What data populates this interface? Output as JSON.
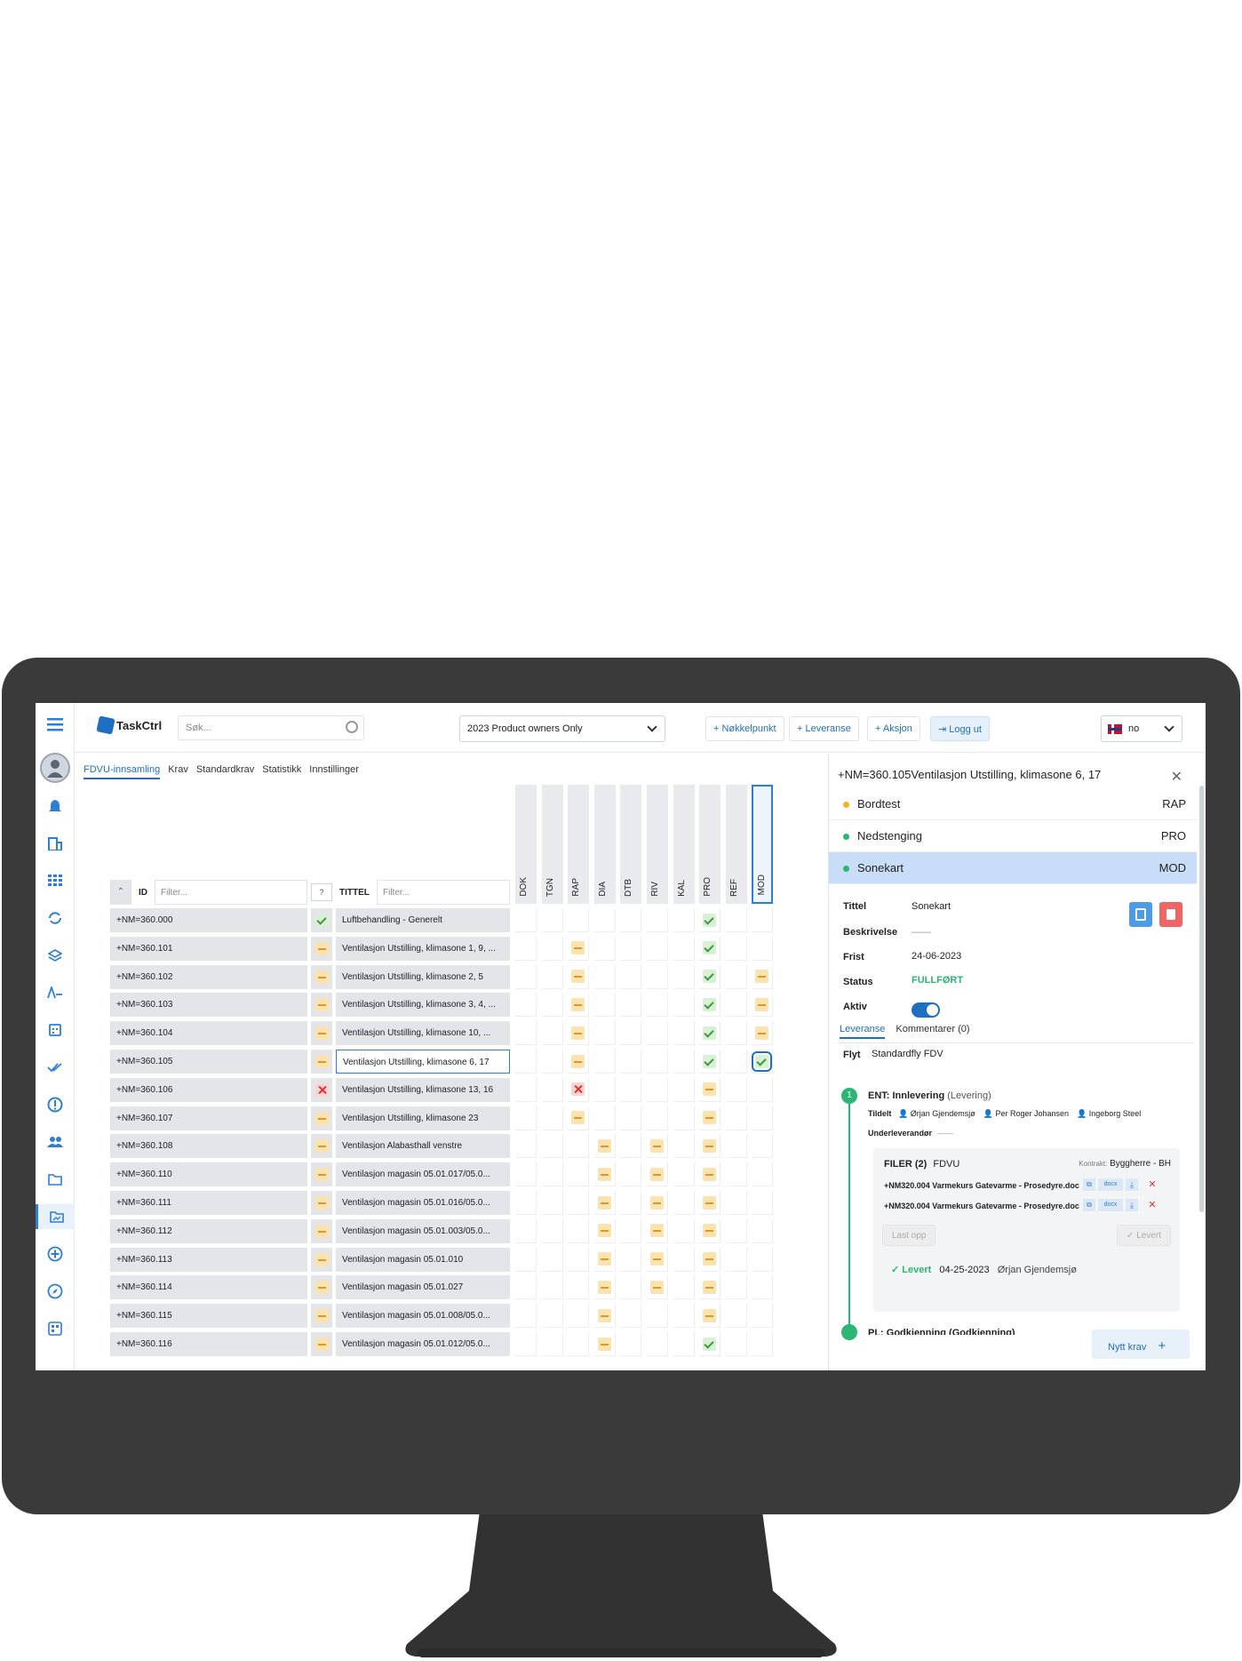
{
  "app": {
    "logo_text": "TaskCtrl",
    "search_placeholder": "Søk...",
    "project": "2023 Product owners Only",
    "buttons": [
      "Nøkkelpunkt",
      "Leveranse",
      "Aksjon",
      "Logg ut"
    ],
    "lang": "no"
  },
  "subtabs": [
    "FDVU-innsamling",
    "Krav",
    "Standardkrav",
    "Statistikk",
    "Innstillinger"
  ],
  "grid": {
    "id_label": "ID",
    "status_label": "?",
    "title_label": "TITTEL",
    "filter_placeholder": "Filter...",
    "columns": [
      "DOK",
      "TGN",
      "RAP",
      "DIA",
      "DTB",
      "RIV",
      "KAL",
      "PRO",
      "REF",
      "MOD"
    ],
    "rows": [
      {
        "id": "+NM=360.000",
        "st": "ok",
        "title": "Luftbehandling - Generelt",
        "marks": {
          "PRO": "ok"
        }
      },
      {
        "id": "+NM=360.101",
        "st": "pend",
        "title": "Ventilasjon Utstilling, klimasone 1, 9, ...",
        "marks": {
          "RAP": "pend",
          "PRO": "ok"
        }
      },
      {
        "id": "+NM=360.102",
        "st": "pend",
        "title": "Ventilasjon Utstilling, klimasone 2, 5",
        "marks": {
          "RAP": "pend",
          "PRO": "ok",
          "MOD": "pend"
        }
      },
      {
        "id": "+NM=360.103",
        "st": "pend",
        "title": "Ventilasjon Utstilling, klimasone 3, 4, ...",
        "marks": {
          "RAP": "pend",
          "PRO": "ok",
          "MOD": "pend"
        }
      },
      {
        "id": "+NM=360.104",
        "st": "pend",
        "title": "Ventilasjon Utstilling, klimasone 10, ...",
        "marks": {
          "RAP": "pend",
          "PRO": "ok",
          "MOD": "pend"
        }
      },
      {
        "id": "+NM=360.105",
        "st": "pend",
        "title": "Ventilasjon Utstilling, klimasone 6, 17",
        "sel": true,
        "marks": {
          "RAP": "pend",
          "PRO": "ok",
          "MOD": "oksel"
        }
      },
      {
        "id": "+NM=360.106",
        "st": "err",
        "title": "Ventilasjon Utstilling, klimasone 13, 16",
        "marks": {
          "RAP": "err",
          "PRO": "pend"
        }
      },
      {
        "id": "+NM=360.107",
        "st": "pend",
        "title": "Ventilasjon Utstilling, klimasone 23",
        "marks": {
          "RAP": "pend",
          "PRO": "pend"
        }
      },
      {
        "id": "+NM=360.108",
        "st": "pend",
        "title": "Ventilasjon Alabasthall venstre",
        "marks": {
          "DIA": "pend",
          "RIV": "pend",
          "PRO": "pend"
        }
      },
      {
        "id": "+NM=360.110",
        "st": "pend",
        "title": "Ventilasjon magasin 05.01.017/05.0...",
        "marks": {
          "DIA": "pend",
          "RIV": "pend",
          "PRO": "pend"
        }
      },
      {
        "id": "+NM=360.111",
        "st": "pend",
        "title": "Ventilasjon magasin 05.01.016/05.0...",
        "marks": {
          "DIA": "pend",
          "RIV": "pend",
          "PRO": "pend"
        }
      },
      {
        "id": "+NM=360.112",
        "st": "pend",
        "title": "Ventilasjon magasin 05.01.003/05.0...",
        "marks": {
          "DIA": "pend",
          "RIV": "pend",
          "PRO": "pend"
        }
      },
      {
        "id": "+NM=360.113",
        "st": "pend",
        "title": "Ventilasjon magasin 05.01.010",
        "marks": {
          "DIA": "pend",
          "RIV": "pend",
          "PRO": "pend"
        }
      },
      {
        "id": "+NM=360.114",
        "st": "pend",
        "title": "Ventilasjon magasin 05.01.027",
        "marks": {
          "DIA": "pend",
          "RIV": "pend",
          "PRO": "pend"
        }
      },
      {
        "id": "+NM=360.115",
        "st": "pend",
        "title": "Ventilasjon magasin 05.01.008/05.0...",
        "marks": {
          "DIA": "pend",
          "PRO": "pend"
        }
      },
      {
        "id": "+NM=360.116",
        "st": "pend",
        "title": "Ventilasjon magasin 05.01.012/05.0...",
        "marks": {
          "DIA": "pend",
          "PRO": "ok"
        }
      }
    ]
  },
  "panel": {
    "title": "+NM=360.105Ventilasjon Utstilling, klimasone 6, 17",
    "items": [
      {
        "label": "Bordtest",
        "code": "RAP",
        "dot": "#f0b429"
      },
      {
        "label": "Nedstenging",
        "code": "PRO",
        "dot": "#2bb673"
      },
      {
        "label": "Sonekart",
        "code": "MOD",
        "dot": "#2bb673"
      }
    ],
    "fields": {
      "tittel_label": "Tittel",
      "tittel": "Sonekart",
      "beskrivelse_label": "Beskrivelse",
      "beskrivelse": "——",
      "frist_label": "Frist",
      "frist": "24-06-2023",
      "status_label": "Status",
      "status": "FULLFØRT",
      "aktiv_label": "Aktiv"
    },
    "tabs": [
      "Leveranse",
      "Kommentarer (0)"
    ],
    "flyt_label": "Flyt",
    "flyt": "Standardfly FDV",
    "step_num": "1",
    "step_title": "ENT: Innlevering",
    "step_sub": "(Levering)",
    "tildelt_label": "Tildelt",
    "assignees": [
      "Ørjan Gjendemsjø",
      "Per Roger Johansen",
      "Ingeborg Steel"
    ],
    "underleverandor_label": "Underleverandør",
    "underleverandor": "——",
    "files_title": "FILER (2)",
    "files_group": "FDVU",
    "kontrakt_label": "Kontrakt:",
    "kontrakt": "Byggherre - BH",
    "files": [
      "+NM320.004 Varmekurs Gatevarme - Prosedyre.doc",
      "+NM320.004 Varmekurs Gatevarme - Prosedyre.doc"
    ],
    "file_badge": "docx",
    "upload_btn": "Last opp",
    "deliver_btn": "Levert",
    "levert_label": "Levert",
    "levert_date": "04-25-2023",
    "levert_by": "Ørjan Gjendemsjø",
    "next_step": "PL: Godkjenning (Godkjenning)",
    "new_btn": "Nytt krav"
  },
  "colors": {
    "accent": "#1d6fc2",
    "ok": "#3a9b3a",
    "pending": "#d89a2a",
    "error": "#dd3333",
    "bezel": "#3a3a3a"
  }
}
